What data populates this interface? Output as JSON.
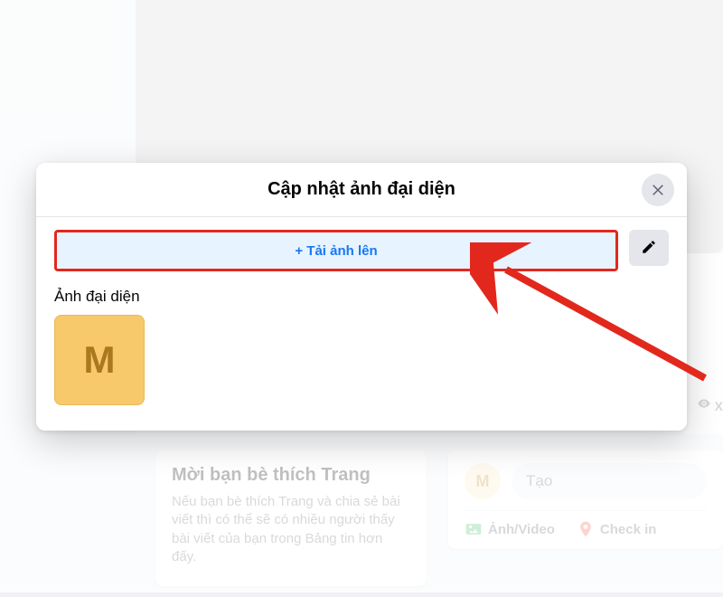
{
  "modal": {
    "title": "Cập nhật ảnh đại diện",
    "upload_label": "+ Tải ảnh lên",
    "section_label": "Ảnh đại diện",
    "avatar_letter": "M"
  },
  "invite": {
    "title": "Mời bạn bè thích Trang",
    "desc": "Nếu bạn bè thích Trang và chia sẻ bài viết thì có thể sẽ có nhiều người thấy bài viết của bạn trong Bảng tin hơn đấy."
  },
  "post": {
    "avatar_letter": "M",
    "prompt": "Tạo",
    "actions": {
      "photo_video": "Ảnh/Video",
      "check_in": "Check in"
    }
  },
  "view_badge": "X",
  "colors": {
    "accent": "#1877f2",
    "highlight": "#e2281d"
  }
}
